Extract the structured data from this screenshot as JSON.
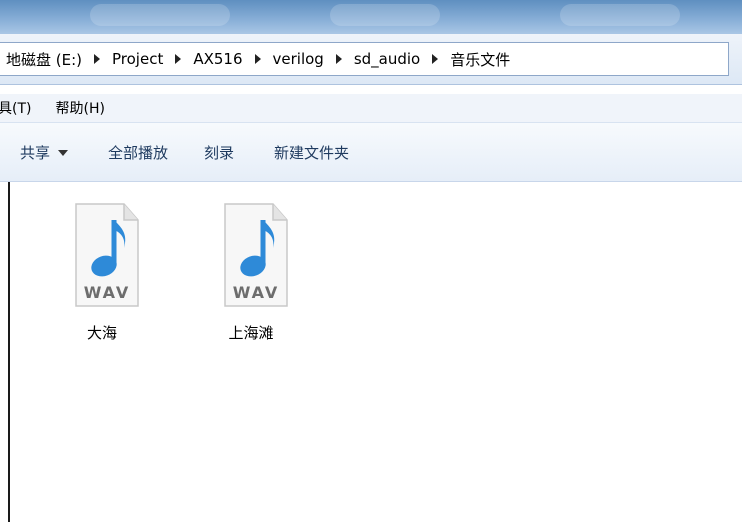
{
  "address_bar": {
    "breadcrumbs": [
      "地磁盘 (E:)",
      "Project",
      "AX516",
      "verilog",
      "sd_audio",
      "音乐文件"
    ]
  },
  "menu_bar": {
    "items": [
      "具(T)",
      "帮助(H)"
    ]
  },
  "toolbar": {
    "share_label": "共享",
    "play_all_label": "全部播放",
    "burn_label": "刻录",
    "new_folder_label": "新建文件夹"
  },
  "files": [
    {
      "name": "大海",
      "type_label": "WAV",
      "icon": "wav-audio-file-icon"
    },
    {
      "name": "上海滩",
      "type_label": "WAV",
      "icon": "wav-audio-file-icon"
    }
  ],
  "colors": {
    "note_blue": "#2e8ad8",
    "toolbar_text": "#1e3a5f",
    "title_blue": "#6f9bca"
  }
}
